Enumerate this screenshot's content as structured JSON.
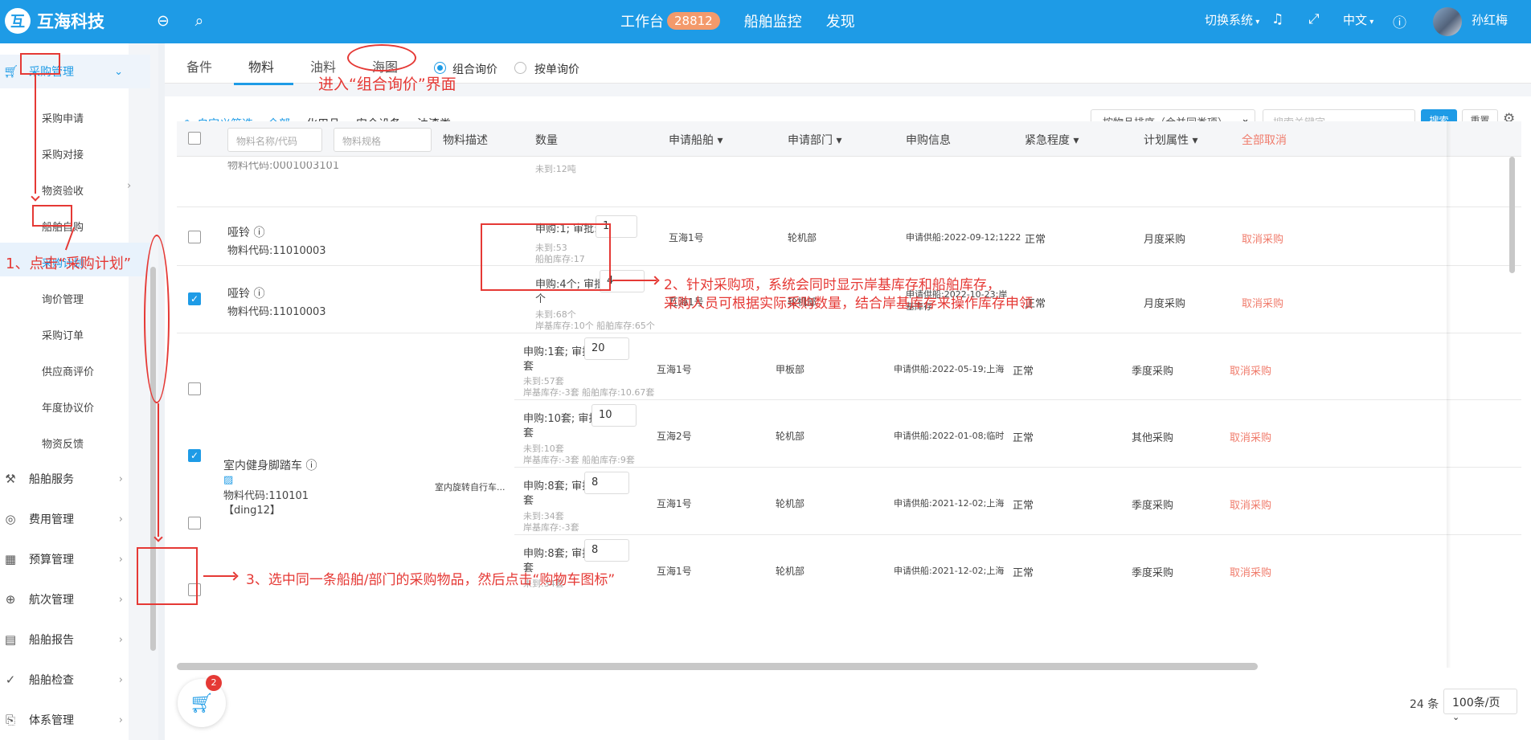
{
  "topbar": {
    "logo_mark": "互",
    "brand": "互海科技",
    "workbench": "工作台",
    "workbench_count": "28812",
    "nav_monitor": "船舶监控",
    "nav_discover": "发现",
    "switch_system": "切换系统",
    "language": "中文",
    "username": "孙红梅"
  },
  "sidebar": {
    "active_group": "采购管理",
    "children": [
      "采购申请",
      "采购对接",
      "物资验收",
      "船舶自购",
      "采购计划",
      "询价管理",
      "采购订单",
      "供应商评价",
      "年度协议价",
      "物资反馈"
    ],
    "groups": [
      "船舶服务",
      "费用管理",
      "预算管理",
      "航次管理",
      "船舶报告",
      "船舶检查",
      "体系管理"
    ]
  },
  "tabs": [
    "备件",
    "物料",
    "油料",
    "海图"
  ],
  "radios": {
    "combined": "组合询价",
    "single": "按单询价"
  },
  "filters": {
    "custom": "自定义筛选",
    "all": "全部",
    "items": [
      "化用品",
      "安全设备",
      "油漆类"
    ]
  },
  "toolbar": {
    "sort_select": "按物品排序（合并同类项）",
    "search_placeholder": "搜索关键字",
    "search_btn": "搜索",
    "reset_btn": "重置"
  },
  "table": {
    "name_placeholder": "物料名称/代码",
    "spec_placeholder": "物料规格",
    "headers": {
      "desc": "物料描述",
      "qty": "数量",
      "ship": "申请船舶",
      "dept": "申请部门",
      "info": "申购信息",
      "urgency": "紧急程度",
      "plan": "计划属性",
      "cancel_all": "全部取消"
    },
    "partial_row": {
      "code": "物料代码:0001003101",
      "unarrived": "未到:12吨"
    },
    "rows": [
      {
        "name": "哑铃",
        "code": "物料代码:11010003",
        "qty_text": "申购:1; 审批:",
        "qty_value": "1",
        "qty_unit": "",
        "line1": "未到:53",
        "line2": "船舶库存:17",
        "ship": "互海1号",
        "dept": "轮机部",
        "info": "申请供船:2022-09-12;1222",
        "urgency": "正常",
        "plan": "月度采购",
        "cancel": "取消采购",
        "checked": false
      },
      {
        "name": "哑铃",
        "code": "物料代码:11010003",
        "qty_text": "申购:4个; 审批:",
        "qty_value": "4",
        "qty_unit": "个",
        "line1": "未到:68个",
        "line2": "岸基库存:10个 船舶库存:65个",
        "ship": "互海1号",
        "dept": "轮机部",
        "info": "申请供船:2022-10-23;岸基库存",
        "urgency": "正常",
        "plan": "月度采购",
        "cancel": "取消采购",
        "checked": true
      },
      {
        "name": "",
        "code": "",
        "qty_text": "申购:1套; 审批:",
        "qty_value": "20",
        "qty_unit": "套",
        "line1": "未到:57套",
        "line2": "岸基库存:-3套 船舶库存:10.67套",
        "ship": "互海1号",
        "dept": "甲板部",
        "info": "申请供船:2022-05-19;上海",
        "urgency": "正常",
        "plan": "季度采购",
        "cancel": "取消采购",
        "checked": false
      },
      {
        "name": "",
        "code": "",
        "qty_text": "申购:10套; 审批:",
        "qty_value": "10",
        "qty_unit": "套",
        "line1": "未到:10套",
        "line2": "岸基库存:-3套 船舶库存:9套",
        "ship": "互海2号",
        "dept": "轮机部",
        "info": "申请供船:2022-01-08;临时",
        "urgency": "正常",
        "plan": "其他采购",
        "cancel": "取消采购",
        "checked": true
      },
      {
        "name": "",
        "code": "",
        "qty_text": "申购:8套; 审批:",
        "qty_value": "8",
        "qty_unit": "套",
        "line1": "未到:34套",
        "line2": "岸基库存:-3套",
        "ship": "互海1号",
        "dept": "轮机部",
        "info": "申请供船:2021-12-02;上海",
        "urgency": "正常",
        "plan": "季度采购",
        "cancel": "取消采购",
        "checked": false
      },
      {
        "name": "",
        "code": "",
        "qty_text": "申购:8套; 审批:",
        "qty_value": "8",
        "qty_unit": "套",
        "line1": "未到:34套",
        "line2": "",
        "ship": "互海1号",
        "dept": "轮机部",
        "info": "申请供船:2021-12-02;上海",
        "urgency": "正常",
        "plan": "季度采购",
        "cancel": "取消采购",
        "checked": false
      }
    ],
    "merged_item": {
      "name": "室内健身脚踏车",
      "code": "物料代码:110101【ding12】",
      "desc": "室内旋转自行车..."
    }
  },
  "cart": {
    "count": "2"
  },
  "pager": {
    "total": "24 条",
    "page_size": "100条/页"
  },
  "annotations": {
    "enter": "进入“组合询价”界面",
    "step1": "1、点击“采购计划”",
    "step2_line1": "2、针对采购项，系统会同时显示岸基库存和船舶库存，",
    "step2_line2": "采购人员可根据实际采购数量，结合岸基库存来操作库存申领",
    "step3": "3、选中同一条船舶/部门的采购物品，然后点击“购物车图标”"
  },
  "colors": {
    "brand": "#1e9be6",
    "annotation": "#e53935",
    "cancel_link": "#f07c6c"
  }
}
